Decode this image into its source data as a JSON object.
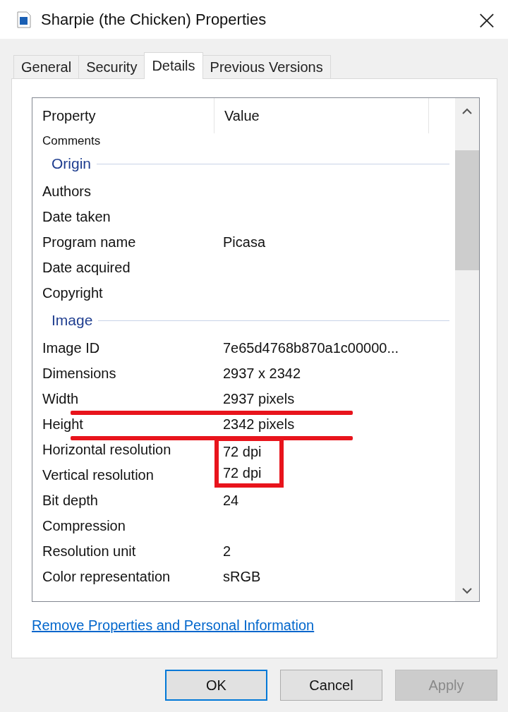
{
  "window": {
    "title": "Sharpie (the Chicken) Properties",
    "close": "×"
  },
  "tabs": [
    {
      "label": "General",
      "selected": false
    },
    {
      "label": "Security",
      "selected": false
    },
    {
      "label": "Details",
      "selected": true
    },
    {
      "label": "Previous Versions",
      "selected": false
    }
  ],
  "list": {
    "columns": [
      "Property",
      "Value"
    ],
    "top_row": "Comments",
    "sections": [
      {
        "title": "Origin",
        "rows": [
          {
            "property": "Authors",
            "underlined": false,
            "boxed": false
          },
          {
            "property": "Date taken",
            "underlined": false,
            "boxed": false
          },
          {
            "property": "Program name",
            "value": "Picasa",
            "underlined": false,
            "boxed": false
          },
          {
            "property": "Date acquired",
            "underlined": false,
            "boxed": false
          },
          {
            "property": "Copyright",
            "underlined": false,
            "boxed": false
          }
        ]
      },
      {
        "title": "Image",
        "rows": [
          {
            "property": "Image ID",
            "value": "7e65d4768b870a1c00000...",
            "underlined": false,
            "boxed": false
          },
          {
            "property": "Dimensions",
            "value": "2937 x 2342",
            "underlined": false,
            "boxed": false
          },
          {
            "property": "Width",
            "value": "2937 pixels",
            "underlined": true,
            "boxed": false
          },
          {
            "property": "Height",
            "value": "2342 pixels",
            "underlined": true,
            "boxed": false
          },
          {
            "property": "Horizontal resolution",
            "value": "72 dpi",
            "underlined": false,
            "boxed": true
          },
          {
            "property": "Vertical resolution",
            "value": "72 dpi",
            "underlined": false,
            "boxed": true
          },
          {
            "property": "Bit depth",
            "value": "24",
            "underlined": false,
            "boxed": false
          },
          {
            "property": "Compression",
            "underlined": false,
            "boxed": false
          },
          {
            "property": "Resolution unit",
            "value": "2",
            "underlined": false,
            "boxed": false
          },
          {
            "property": "Color representation",
            "value": "sRGB",
            "underlined": false,
            "boxed": false
          }
        ]
      }
    ]
  },
  "link": "Remove Properties and Personal Information",
  "buttons": [
    {
      "label": "OK",
      "kind": "default",
      "disabled": false
    },
    {
      "label": "Cancel",
      "kind": "normal",
      "disabled": false
    },
    {
      "label": "Apply",
      "kind": "normal",
      "disabled": true
    }
  ]
}
